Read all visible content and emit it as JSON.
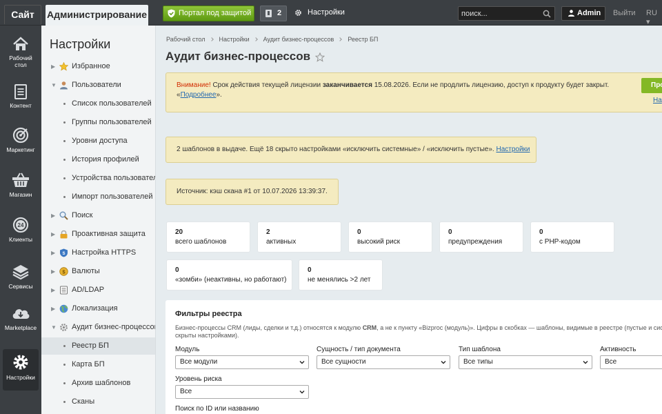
{
  "topbar": {
    "site_tab": "Сайт",
    "admin_tab": "Администрирование",
    "portal_button": "Портал под защитой",
    "notifications_count": "2",
    "settings_label": "Настройки",
    "search_placeholder": "поиск...",
    "user_name": "Admin",
    "logout_label": "Выйти",
    "language": "RU"
  },
  "left_menu": [
    {
      "label": "Рабочий стол",
      "icon": "house-icon"
    },
    {
      "label": "Контент",
      "icon": "document-icon"
    },
    {
      "label": "Маркетинг",
      "icon": "target-icon"
    },
    {
      "label": "Магазин",
      "icon": "basket-icon"
    },
    {
      "label": "Клиенты",
      "icon": "clock-24-icon"
    },
    {
      "label": "Сервисы",
      "icon": "layers-icon"
    },
    {
      "label": "Marketplace",
      "icon": "cloud-download-icon"
    },
    {
      "label": "Настройки",
      "icon": "gear-icon",
      "active": true
    }
  ],
  "sidebar": {
    "title": "Настройки",
    "items": [
      {
        "label": "Избранное",
        "icon": "star-icon",
        "arrow": true
      },
      {
        "label": "Пользователи",
        "icon": "user-icon",
        "arrow": true,
        "expanded": true
      },
      {
        "label": "Список пользователей",
        "sub": true
      },
      {
        "label": "Группы пользователей",
        "sub": true
      },
      {
        "label": "Уровни доступа",
        "sub": true
      },
      {
        "label": "История профилей",
        "sub": true
      },
      {
        "label": "Устройства пользователей",
        "sub": true
      },
      {
        "label": "Импорт пользователей",
        "sub": true
      },
      {
        "label": "Поиск",
        "icon": "search-icon",
        "arrow": true
      },
      {
        "label": "Проактивная защита",
        "icon": "lock-icon",
        "arrow": true
      },
      {
        "label": "Настройка HTTPS",
        "icon": "https-icon",
        "arrow": true
      },
      {
        "label": "Валюты",
        "icon": "coin-icon",
        "arrow": true
      },
      {
        "label": "AD/LDAP",
        "icon": "ldap-icon",
        "arrow": true
      },
      {
        "label": "Локализация",
        "icon": "globe-icon",
        "arrow": true
      },
      {
        "label": "Аудит бизнес-процессов",
        "icon": "gear-icon",
        "arrow": true,
        "expanded": true
      },
      {
        "label": "Реестр БП",
        "sub": true,
        "active": true
      },
      {
        "label": "Карта БП",
        "sub": true
      },
      {
        "label": "Архив шаблонов",
        "sub": true
      },
      {
        "label": "Сканы",
        "sub": true
      }
    ]
  },
  "breadcrumb": [
    "Рабочий стол",
    "Настройки",
    "Аудит бизнес-процессов",
    "Реестр БП"
  ],
  "page_title": "Аудит бизнес-процессов",
  "warning": {
    "attention": "Внимание!",
    "text1": " Срок действия текущей лицензии ",
    "strong": "заканчивается",
    "text2": " 15.08.2026. Если не продлить лицензию, доступ к продукту будет закрыт.",
    "quote_open": "«",
    "link": "Подробнее",
    "quote_close": "».",
    "button": "Про",
    "link2": "На"
  },
  "templates_note": {
    "text": "2 шаблонов в выдаче. Ещё 18 скрыто настройками «исключить системные» / «исключить пустые». ",
    "link": "Настройки"
  },
  "source_note": "Источник: кэш скана #1 от 10.07.2026 13:39:37.",
  "stats": [
    {
      "value": "20",
      "label": "всего шаблонов"
    },
    {
      "value": "2",
      "label": "активных"
    },
    {
      "value": "0",
      "label": "высокий риск"
    },
    {
      "value": "0",
      "label": "предупреждения"
    },
    {
      "value": "0",
      "label": "с PHP-кодом"
    },
    {
      "value": "0",
      "label": "«зомби» (неактивны, но работают)"
    },
    {
      "value": "0",
      "label": "не менялись >2 лет"
    }
  ],
  "filters": {
    "title": "Фильтры реестра",
    "desc_pre": "Бизнес-процессы CRM (лиды, сделки и т.д.) относятся к модулю ",
    "desc_strong": "CRM",
    "desc_post": ", а не к пункту «Bizproc (модуль)». Цифры в скобках — шаблоны, видимые в реестре (пустые и сис скрыты настройками).",
    "fields": [
      {
        "label": "Модуль",
        "value": "Все модули"
      },
      {
        "label": "Сущность / тип документа",
        "value": "Все сущности"
      },
      {
        "label": "Тип шаблона",
        "value": "Все типы"
      },
      {
        "label": "Активность",
        "value": "Все"
      },
      {
        "label": "Уровень риска",
        "value": "Все"
      }
    ],
    "search_label": "Поиск по ID или названию"
  }
}
